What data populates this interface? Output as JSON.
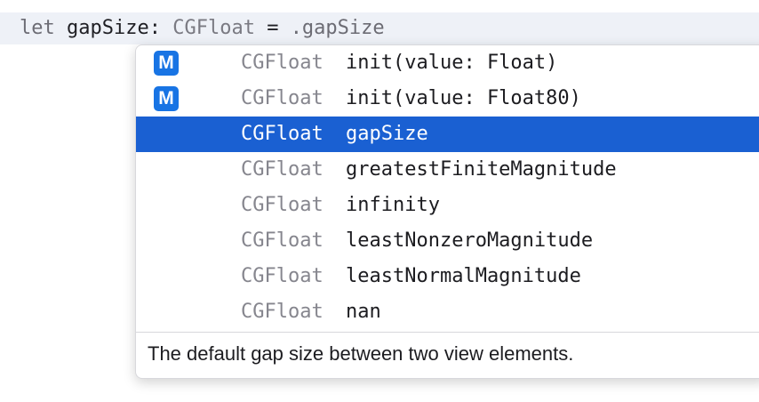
{
  "editor": {
    "line_tokens": {
      "keyword": "let",
      "identifier": "gapSize",
      "colon": ":",
      "type": "CGFloat",
      "equals": "=",
      "member": ".gapSize"
    }
  },
  "completion": {
    "items": [
      {
        "badge": "M",
        "type": "CGFloat",
        "name": "init(value: Float)",
        "selected": false
      },
      {
        "badge": "M",
        "type": "CGFloat",
        "name": "init(value: Float80)",
        "selected": false
      },
      {
        "badge": "",
        "type": "CGFloat",
        "name": "gapSize",
        "selected": true
      },
      {
        "badge": "",
        "type": "CGFloat",
        "name": "greatestFiniteMagnitude",
        "selected": false
      },
      {
        "badge": "",
        "type": "CGFloat",
        "name": "infinity",
        "selected": false
      },
      {
        "badge": "",
        "type": "CGFloat",
        "name": "leastNonzeroMagnitude",
        "selected": false
      },
      {
        "badge": "",
        "type": "CGFloat",
        "name": "leastNormalMagnitude",
        "selected": false
      },
      {
        "badge": "",
        "type": "CGFloat",
        "name": "nan",
        "selected": false
      }
    ],
    "documentation": "The default gap size between two view elements."
  },
  "colors": {
    "selection": "#1a60d2",
    "method_badge": "#1874e4",
    "code_line_highlight": "#eef1f7"
  }
}
